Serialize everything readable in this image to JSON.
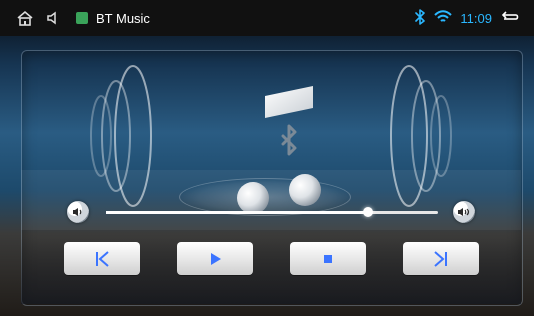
{
  "statusbar": {
    "app_title": "BT Music",
    "time": "11:09",
    "icons": [
      "home-icon",
      "back-icon",
      "bluetooth-icon",
      "wifi-icon",
      "return-icon"
    ]
  },
  "player": {
    "volume_level_fraction": 0.79,
    "controls": [
      {
        "name": "previous-button",
        "icon": "skip-previous-icon"
      },
      {
        "name": "play-button",
        "icon": "play-icon"
      },
      {
        "name": "stop-button",
        "icon": "stop-icon"
      },
      {
        "name": "next-button",
        "icon": "skip-next-icon"
      }
    ]
  },
  "colors": {
    "statusbar_bg": "#111111",
    "accent_blue": "#2ab7ff",
    "button_icon_blue": "#3b74ff"
  }
}
